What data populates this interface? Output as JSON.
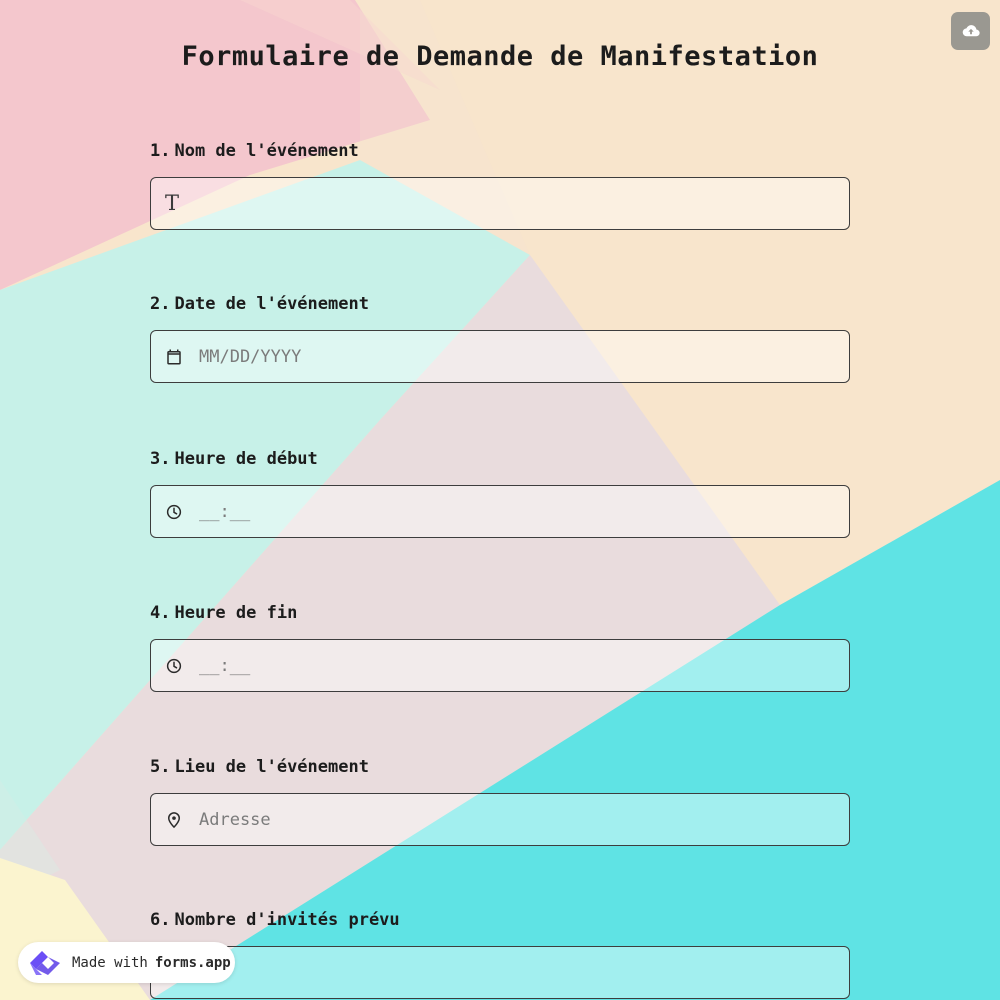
{
  "header": {
    "title": "Formulaire de Demande de Manifestation",
    "upload_icon": "cloud-upload-icon"
  },
  "questions": [
    {
      "number": "1.",
      "label": "Nom de l'événement",
      "icon": "text-type-icon",
      "glyph": "T",
      "value": "",
      "placeholder": ""
    },
    {
      "number": "2.",
      "label": "Date de l'événement",
      "icon": "calendar-icon",
      "value": "",
      "placeholder": "MM/DD/YYYY"
    },
    {
      "number": "3.",
      "label": "Heure de début",
      "icon": "clock-icon",
      "value": "",
      "placeholder": "__:__"
    },
    {
      "number": "4.",
      "label": "Heure de fin",
      "icon": "clock-icon",
      "value": "",
      "placeholder": "__:__"
    },
    {
      "number": "5.",
      "label": "Lieu de l'événement",
      "icon": "location-pin-icon",
      "value": "",
      "placeholder": "Adresse"
    },
    {
      "number": "6.",
      "label": "Nombre d'invités prévu",
      "icon": "",
      "value": "",
      "placeholder": ""
    }
  ],
  "badge": {
    "made_with": "Made with",
    "brand": "forms.app",
    "logo_icon": "forms-app-logo-icon"
  },
  "colors": {
    "pink": "#f4c7cd",
    "mint": "#c5f1e8",
    "peach": "#f8e5cc",
    "lilac": "#e9dcdd",
    "turquoise": "#5de3e3",
    "cream": "#fbf4cf",
    "upload_button": "#9a9891",
    "logo_purple": "#6b4ff6"
  }
}
